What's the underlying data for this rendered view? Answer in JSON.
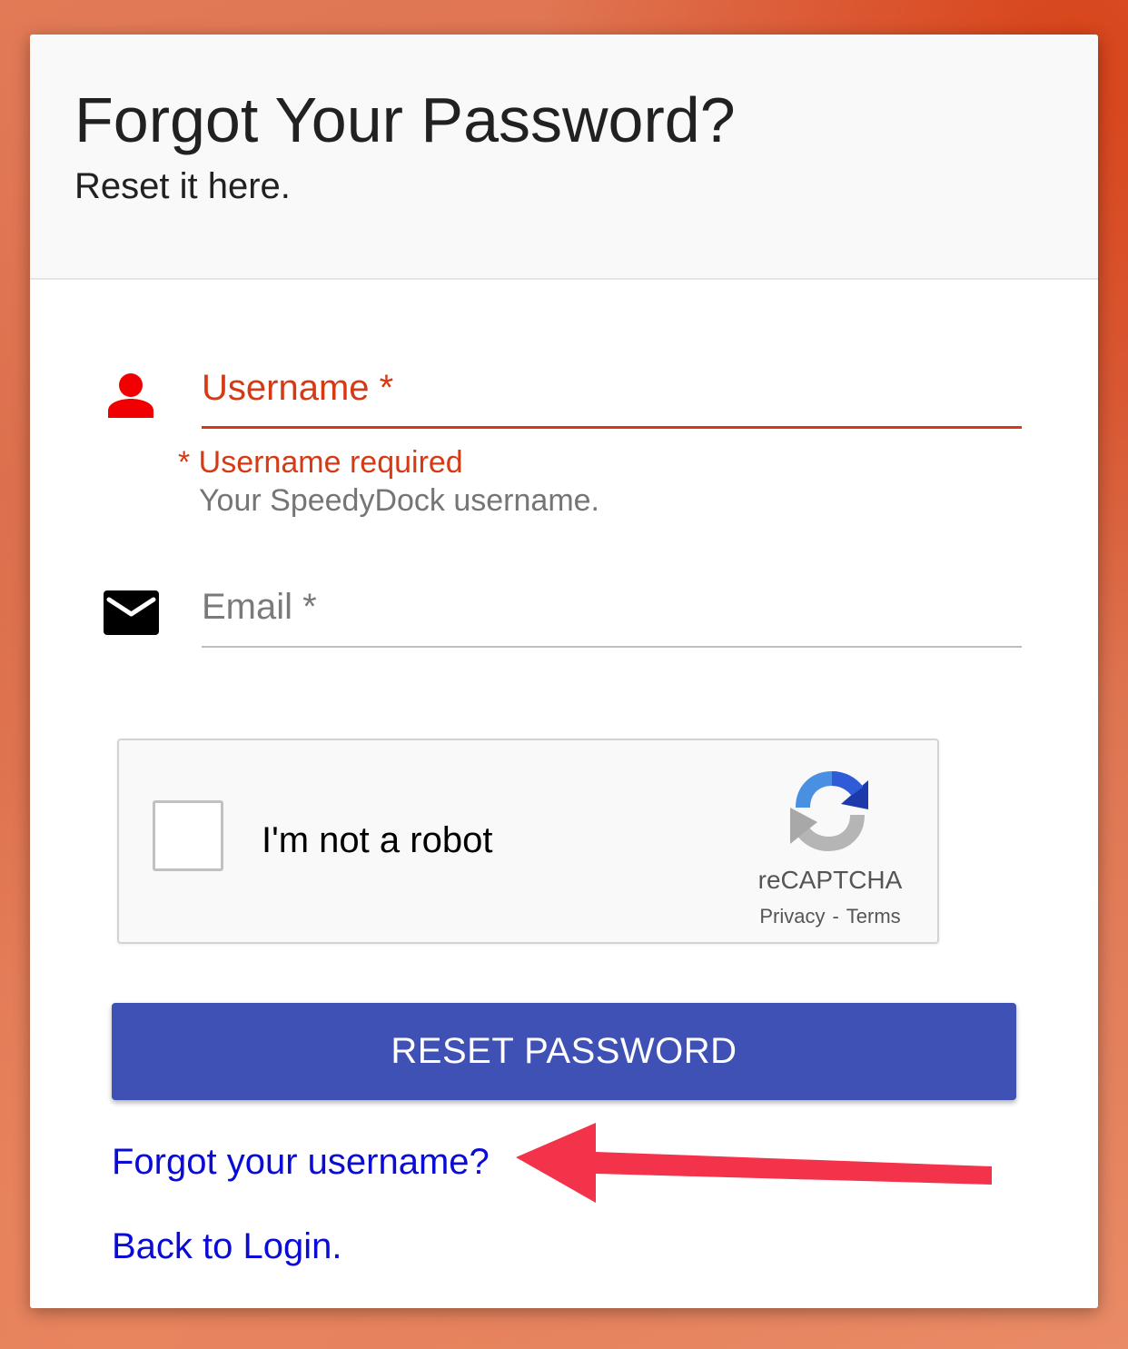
{
  "header": {
    "title": "Forgot Your Password?",
    "subtitle": "Reset it here."
  },
  "form": {
    "username": {
      "label": "Username *",
      "icon": "person-icon",
      "error": "* Username required",
      "helper": "Your SpeedyDock username.",
      "color": "#d63a14"
    },
    "email": {
      "label": "Email *",
      "icon": "mail-icon"
    }
  },
  "recaptcha": {
    "label": "I'm not a robot",
    "brand": "reCAPTCHA",
    "privacy": "Privacy",
    "separator": "-",
    "terms": "Terms"
  },
  "actions": {
    "reset_label": "RESET PASSWORD",
    "button_color": "#3f51b5",
    "forgot_username": "Forgot your username?",
    "back_to_login": "Back to Login."
  },
  "annotation": {
    "arrow_color": "#f2334a"
  }
}
